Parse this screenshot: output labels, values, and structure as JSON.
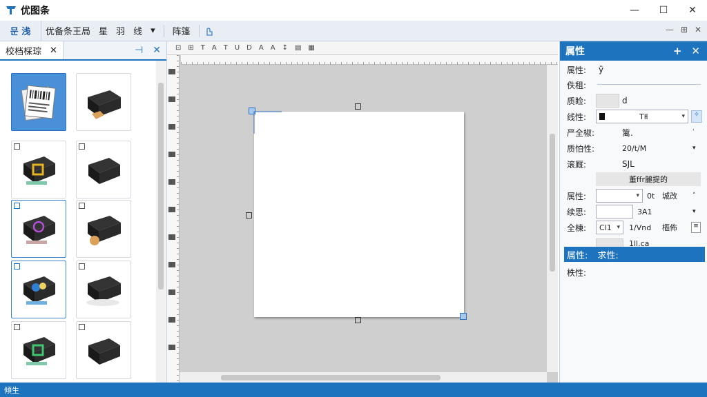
{
  "titlebar": {
    "title": "优图条",
    "minimize": "—",
    "maximize": "☐",
    "close": "✕"
  },
  "menubar": {
    "file_button": "문 浅",
    "items": [
      "优备条王局",
      "星",
      "羽",
      "线"
    ],
    "dropdown": "▾",
    "extra": "阵篷",
    "right_controls": [
      "—",
      "⊞",
      "✕"
    ]
  },
  "left_panel": {
    "tab_label": "校档棌琮",
    "tab_close": "✕",
    "pin": "⊣",
    "close": "✕"
  },
  "canvas": {
    "toolbar_icons": [
      "⊡",
      "⊞",
      "T",
      "A",
      "T",
      "U",
      "D",
      "A",
      "A",
      "↕",
      "▤",
      "▦"
    ]
  },
  "right_panel": {
    "title": "属性",
    "add": "+",
    "close": "✕",
    "rows": {
      "r1": {
        "label": "属性:",
        "value": "ÿ"
      },
      "r2": {
        "label": "佚租:"
      },
      "r3": {
        "label": "质睑:",
        "value": "d"
      },
      "r4": {
        "label": "线性:",
        "value": "Tŀl"
      },
      "r5": {
        "label": "严全椒:",
        "value": "篱."
      },
      "r6": {
        "label": "质怕性:",
        "value": "20/t/M"
      },
      "r7": {
        "label": "滚厩:",
        "value": "SJL"
      },
      "r8_button": "董ffr麗提的",
      "r9": {
        "label": "属性:",
        "value": "0t",
        "extra": "城改"
      },
      "r10": {
        "label": "续思:",
        "value": "3A1"
      },
      "r11": {
        "label": "全棟:",
        "value": "Cl1",
        "extra": "1/Vnd",
        "extra2": "樞佈"
      },
      "r12": {
        "value": "1ll.ca"
      },
      "section": {
        "label": "属性:",
        "value": "求性:"
      },
      "r13": {
        "label": "柣性:"
      }
    }
  },
  "statusbar": {
    "text": "傾生"
  },
  "colors": {
    "accent": "#1e73be",
    "selected": "#4a90d9"
  }
}
